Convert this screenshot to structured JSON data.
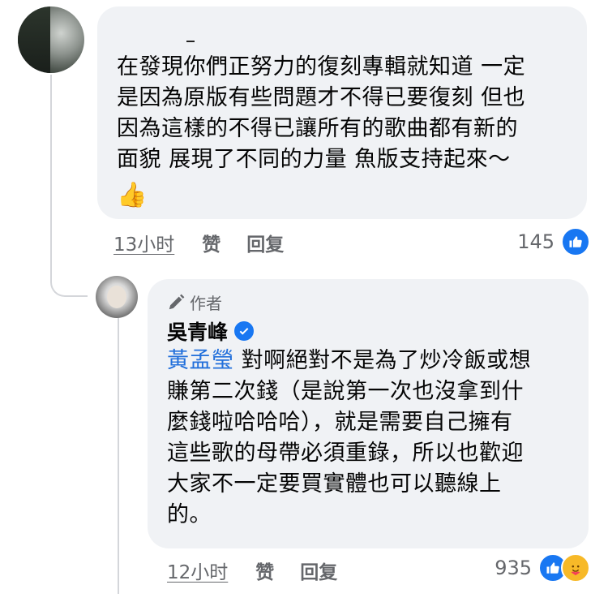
{
  "comment_1": {
    "text": "在發現你們正努力的復刻專輯就知道 一定\n是因為原版有些問題才不得已要復刻 但也\n因為這樣的不得已讓所有的歌曲都有新的\n面貌 展現了不同的力量  魚版支持起來～",
    "emoji": "👍",
    "time": "13小时",
    "like_label": "赞",
    "reply_label": "回复",
    "reaction_count": "145"
  },
  "comment_2": {
    "author_badge": "作者",
    "author_name": "吳青峰",
    "mention": "黃孟瑩",
    "text_first_line": " 對啊絕對不是為了炒冷飯或想",
    "text_rest": "賺第二次錢（是說第一次也沒拿到什\n麼錢啦哈哈哈），就是需要自己擁有\n這些歌的母帶必須重錄，所以也歡迎\n大家不一定要買實體也可以聽線上\n的。",
    "time": "12小时",
    "like_label": "赞",
    "reply_label": "回复",
    "reaction_count": "935"
  },
  "colors": {
    "bubble": "#f0f2f5",
    "link": "#216fdb",
    "meta": "#65676b",
    "like_blue": "#1877f2",
    "care_yellow": "#f7b928"
  }
}
